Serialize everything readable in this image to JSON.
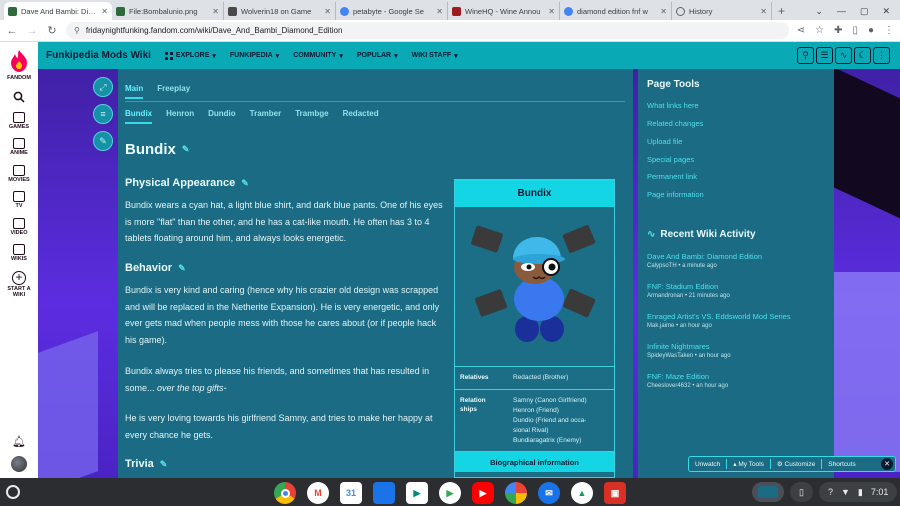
{
  "browser": {
    "tabs": [
      {
        "title": "Dave And Bambi: Diam",
        "favicon_color": "#2f6b3a",
        "active": true
      },
      {
        "title": "File:Bombalunio.png",
        "favicon_color": "#2f6b3a",
        "active": false
      },
      {
        "title": "Wolverin18 on Game",
        "favicon_color": "#4a4a4a",
        "active": false
      },
      {
        "title": "petabyte - Google Se",
        "favicon_color": "#4285f4",
        "active": false
      },
      {
        "title": "WineHQ - Wine Annou",
        "favicon_color": "#a01c1c",
        "active": false
      },
      {
        "title": "diamond edition fnf w",
        "favicon_color": "#4285f4",
        "active": false
      },
      {
        "title": "History",
        "favicon_color": "#5f6368",
        "active": false
      }
    ],
    "url": "fridaynightfunking.fandom.com/wiki/Dave_And_Bambi_Diamond_Edition"
  },
  "rail": {
    "brand": "FANDOM",
    "items": [
      "GAMES",
      "ANIME",
      "MOVIES",
      "TV",
      "VIDEO",
      "WIKIS",
      "START A WIKI"
    ]
  },
  "wiki_header": {
    "name": "Funkipedia Mods Wiki",
    "nav": [
      "EXPLORE",
      "FUNKIPEDIA",
      "COMMUNITY",
      "POPULAR",
      "WIKI STAFF"
    ]
  },
  "article": {
    "mode_tabs": [
      "Main",
      "Freeplay"
    ],
    "char_tabs": [
      "Bundix",
      "Henron",
      "Dundio",
      "Tramber",
      "Trambge",
      "Redacted"
    ],
    "title": "Bundix",
    "sections": [
      {
        "heading": "Physical Appearance"
      },
      {
        "heading": "Behavior"
      },
      {
        "heading": "Trivia"
      }
    ],
    "paragraphs": {
      "appearance": "Bundix wears a cyan hat, a light blue shirt, and dark blue pants. One of his eyes is more \"flat\" than the other, and he has a cat-like mouth. He often has 3 to 4 tablets floating around him, and always looks energetic.",
      "behavior_1": "Bundix is very kind and caring (hence why his crazier old design was scrapped and will be replaced in the Netherite Expansion). He is very energetic, and only ever gets mad when people mess with those he cares about (or if people hack his game).",
      "behavior_2_plain": "Bundix always tries to please his friends, and sometimes that has resulted in some... ",
      "behavior_2_italic": "over the top gifts-",
      "behavior_3": "He is very loving towards his girlfriend Samny, and tries to make her happy at every chance he gets."
    }
  },
  "infobox": {
    "title": "Bundix",
    "rows": [
      {
        "key": "Relatives",
        "values": [
          "Redacted (Brother)"
        ]
      },
      {
        "key": "Relationships",
        "values": [
          "Samny (Canon Girlfriend)",
          "Henron (Friend)",
          "Dundio (Friend and occa-",
          "sional Rival)",
          "Bundiaragatrix (Enemy)"
        ]
      }
    ],
    "footer": "Biographical information"
  },
  "right_rail": {
    "page_tools_title": "Page Tools",
    "page_tools": [
      "What links here",
      "Related changes",
      "Upload file",
      "Special pages",
      "Permanent link",
      "Page information"
    ],
    "activity_title": "Recent Wiki Activity",
    "activity": [
      {
        "title": "Dave And Bambi: Diamond Edition",
        "meta": "CalypsoTH • a minute ago"
      },
      {
        "title": "FNF: Stadium Edition",
        "meta": "Armandronan • 21 minutes ago"
      },
      {
        "title": "Enraged Artist's VS. Eddsworld Mod Series",
        "meta": "Mak.jaime • an hour ago"
      },
      {
        "title": "Infinite Nightmares",
        "meta": "SpideyWasTaken • an hour ago"
      },
      {
        "title": "FNF: Maze Edition",
        "meta": "Cheeslover4632 • an hour ago"
      }
    ]
  },
  "bottom_toolbar": {
    "unwatch": "Unwatch",
    "mytools": "My Tools",
    "customize": "Customize",
    "shortcuts": "Shortcuts"
  },
  "shelf": {
    "apps": [
      {
        "name": "chrome",
        "color": "#e8453c"
      },
      {
        "name": "gmail",
        "color": "#ffffff"
      },
      {
        "name": "calendar",
        "color": "#4285f4"
      },
      {
        "name": "files",
        "color": "#1a73e8"
      },
      {
        "name": "meet",
        "color": "#00897b"
      },
      {
        "name": "play-store",
        "color": "#34a853"
      },
      {
        "name": "youtube",
        "color": "#ff0000"
      },
      {
        "name": "photos",
        "color": "#fbbc04"
      },
      {
        "name": "messages",
        "color": "#1a73e8"
      },
      {
        "name": "drive",
        "color": "#0f9d58"
      },
      {
        "name": "app",
        "color": "#d93025"
      }
    ],
    "time": "7:01"
  }
}
